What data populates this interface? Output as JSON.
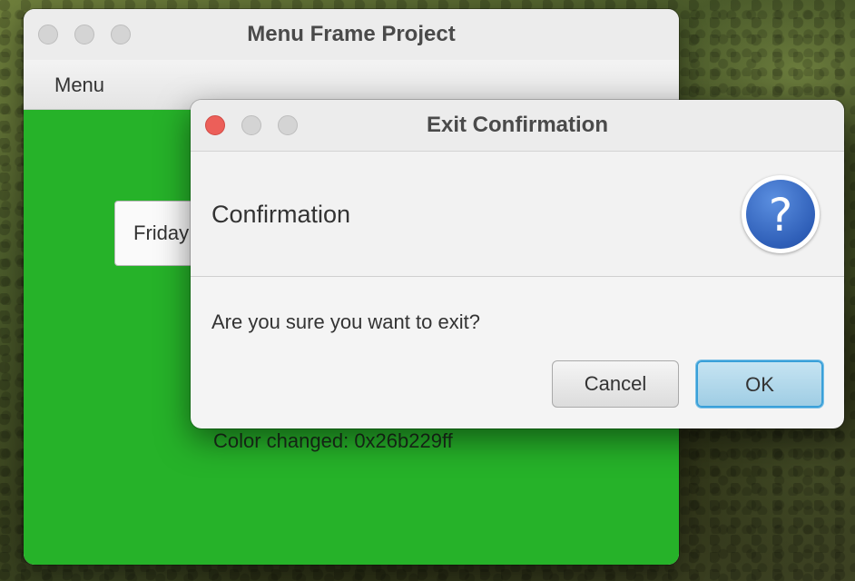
{
  "main_window": {
    "title": "Menu Frame Project",
    "menu_label": "Menu",
    "day_field_value": "Friday",
    "status_text": "Color changed: 0x26b229ff",
    "background_color": "#26b229"
  },
  "dialog": {
    "title": "Exit Confirmation",
    "header_text": "Confirmation",
    "icon_glyph": "?",
    "message": "Are you sure you want to exit?",
    "cancel_label": "Cancel",
    "ok_label": "OK"
  },
  "icons": {
    "dialog_icon": "question-icon"
  }
}
